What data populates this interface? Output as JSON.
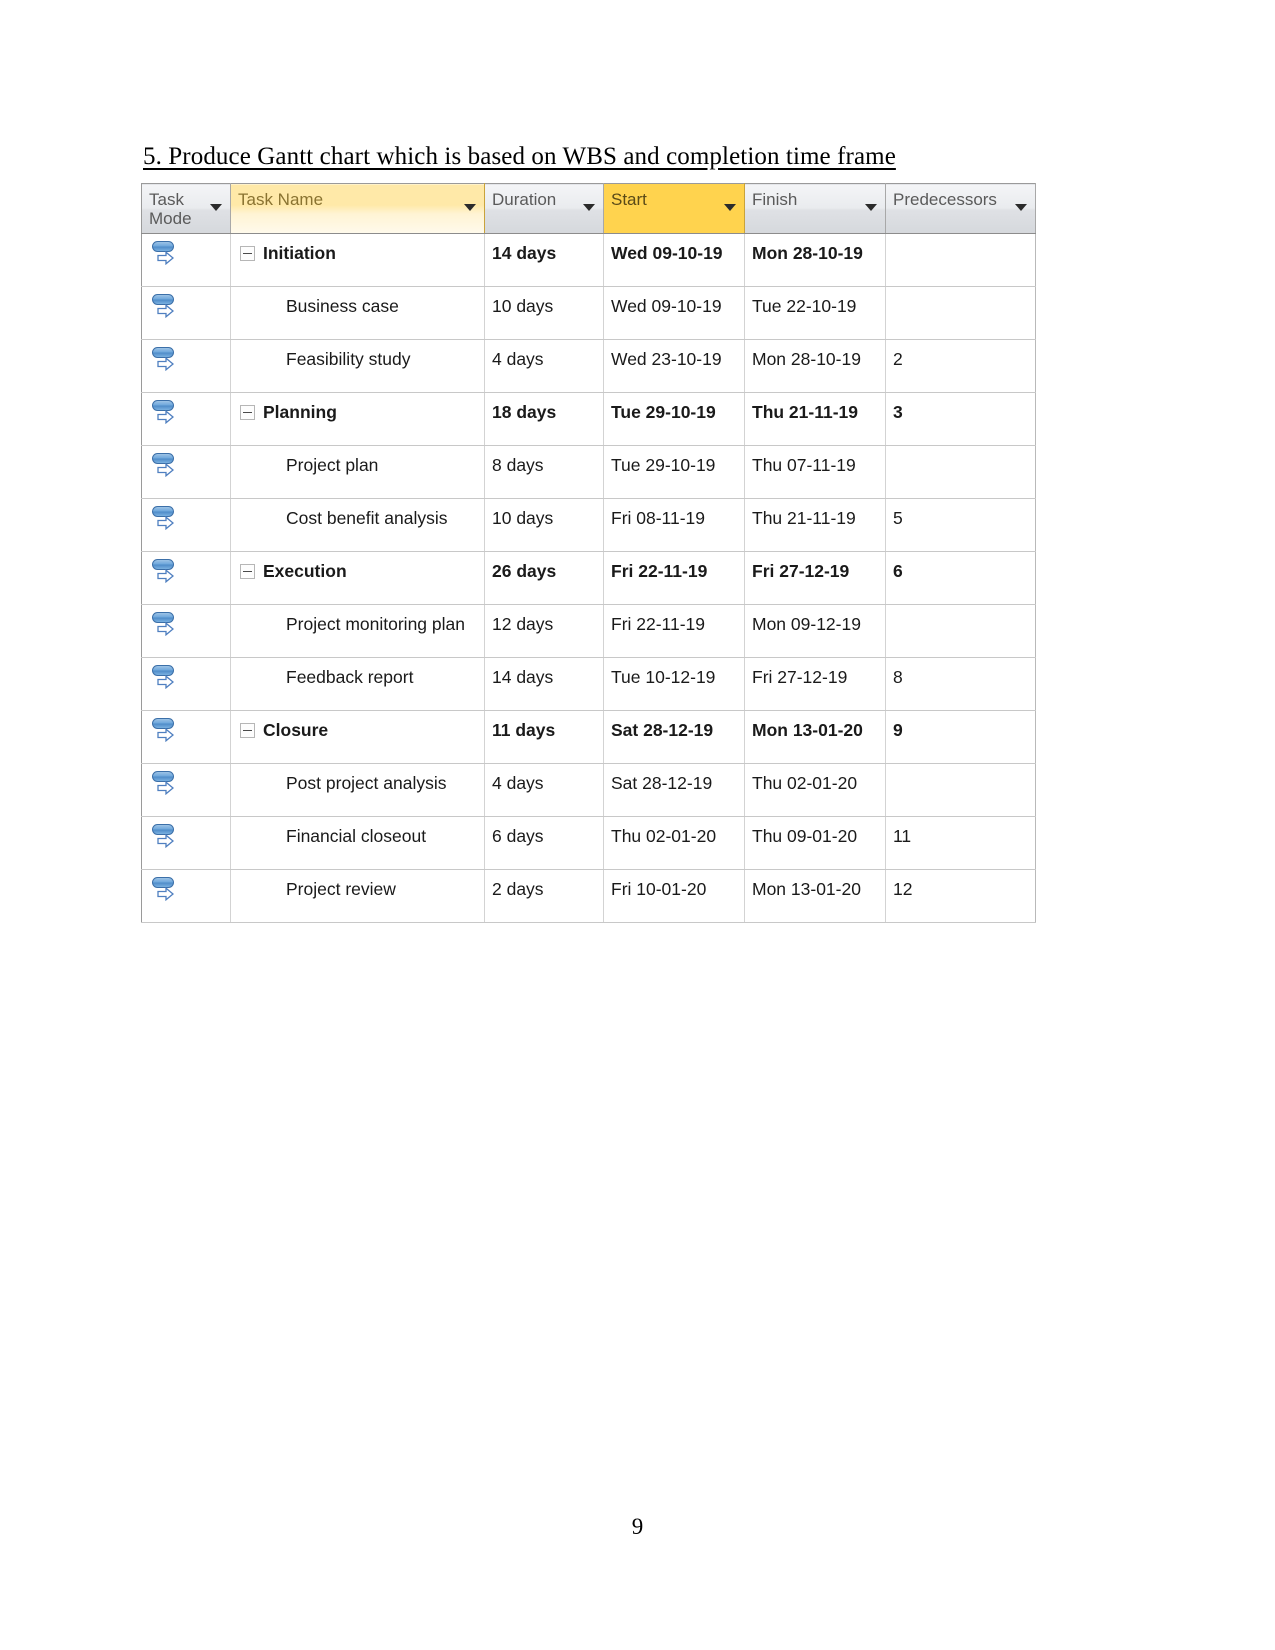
{
  "document": {
    "heading": "5. Produce Gantt chart which is based on WBS and completion time frame",
    "page_number": "9"
  },
  "colors": {
    "header_highlight_light": "#FFE9A8",
    "header_highlight_strong": "#FFD34E",
    "header_default": "#E3E5E9",
    "grid_line": "#C8C8C8",
    "task_mode_icon_blue": "#4F8CC9"
  },
  "table": {
    "columns": [
      {
        "key": "task_mode",
        "label": "Task Mode",
        "has_filter": true,
        "highlight": "none"
      },
      {
        "key": "task_name",
        "label": "Task Name",
        "has_filter": true,
        "highlight": "light"
      },
      {
        "key": "duration",
        "label": "Duration",
        "has_filter": true,
        "highlight": "none"
      },
      {
        "key": "start",
        "label": "Start",
        "has_filter": true,
        "highlight": "strong"
      },
      {
        "key": "finish",
        "label": "Finish",
        "has_filter": true,
        "highlight": "none"
      },
      {
        "key": "predecessors",
        "label": "Predecessors",
        "has_filter": true,
        "highlight": "none"
      }
    ],
    "rows": [
      {
        "task_mode_icon": "manually-scheduled-task-icon",
        "is_summary": true,
        "collapse_state": "expanded",
        "task_name": "Initiation",
        "duration": "14 days",
        "start": "Wed 09-10-19",
        "finish": "Mon 28-10-19",
        "predecessors": ""
      },
      {
        "task_mode_icon": "manually-scheduled-task-icon",
        "is_summary": false,
        "collapse_state": "none",
        "task_name": "Business case",
        "duration": "10 days",
        "start": "Wed 09-10-19",
        "finish": "Tue 22-10-19",
        "predecessors": ""
      },
      {
        "task_mode_icon": "manually-scheduled-task-icon",
        "is_summary": false,
        "collapse_state": "none",
        "task_name": "Feasibility study",
        "duration": "4 days",
        "start": "Wed 23-10-19",
        "finish": "Mon 28-10-19",
        "predecessors": "2"
      },
      {
        "task_mode_icon": "manually-scheduled-task-icon",
        "is_summary": true,
        "collapse_state": "expanded",
        "task_name": "Planning",
        "duration": "18 days",
        "start": "Tue 29-10-19",
        "finish": "Thu 21-11-19",
        "predecessors": "3"
      },
      {
        "task_mode_icon": "manually-scheduled-task-icon",
        "is_summary": false,
        "collapse_state": "none",
        "task_name": "Project plan",
        "duration": "8 days",
        "start": "Tue 29-10-19",
        "finish": "Thu 07-11-19",
        "predecessors": ""
      },
      {
        "task_mode_icon": "manually-scheduled-task-icon",
        "is_summary": false,
        "collapse_state": "none",
        "task_name": "Cost benefit analysis",
        "duration": "10 days",
        "start": "Fri 08-11-19",
        "finish": "Thu 21-11-19",
        "predecessors": "5"
      },
      {
        "task_mode_icon": "manually-scheduled-task-icon",
        "is_summary": true,
        "collapse_state": "expanded",
        "task_name": "Execution",
        "duration": "26 days",
        "start": "Fri 22-11-19",
        "finish": "Fri 27-12-19",
        "predecessors": "6"
      },
      {
        "task_mode_icon": "manually-scheduled-task-icon",
        "is_summary": false,
        "collapse_state": "none",
        "task_name": "Project monitoring plan",
        "duration": "12 days",
        "start": "Fri 22-11-19",
        "finish": "Mon 09-12-19",
        "predecessors": ""
      },
      {
        "task_mode_icon": "manually-scheduled-task-icon",
        "is_summary": false,
        "collapse_state": "none",
        "task_name": "Feedback report",
        "duration": "14 days",
        "start": "Tue 10-12-19",
        "finish": "Fri 27-12-19",
        "predecessors": "8"
      },
      {
        "task_mode_icon": "manually-scheduled-task-icon",
        "is_summary": true,
        "collapse_state": "expanded",
        "task_name": "Closure",
        "duration": "11 days",
        "start": "Sat 28-12-19",
        "finish": "Mon 13-01-20",
        "predecessors": "9"
      },
      {
        "task_mode_icon": "manually-scheduled-task-icon",
        "is_summary": false,
        "collapse_state": "none",
        "task_name": "Post project analysis",
        "duration": "4 days",
        "start": "Sat 28-12-19",
        "finish": "Thu 02-01-20",
        "predecessors": ""
      },
      {
        "task_mode_icon": "manually-scheduled-task-icon",
        "is_summary": false,
        "collapse_state": "none",
        "task_name": "Financial closeout",
        "duration": "6 days",
        "start": "Thu 02-01-20",
        "finish": "Thu 09-01-20",
        "predecessors": "11"
      },
      {
        "task_mode_icon": "manually-scheduled-task-icon",
        "is_summary": false,
        "collapse_state": "none",
        "task_name": "Project review",
        "duration": "2 days",
        "start": "Fri 10-01-20",
        "finish": "Mon 13-01-20",
        "predecessors": "12"
      }
    ]
  }
}
